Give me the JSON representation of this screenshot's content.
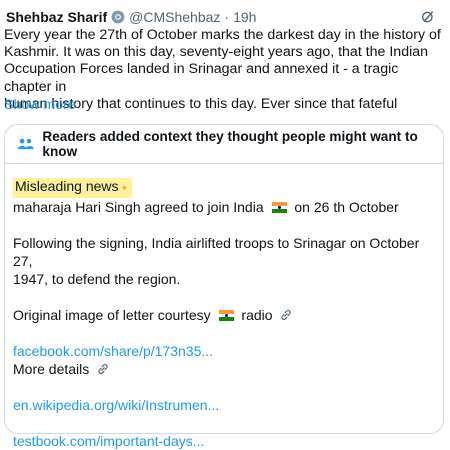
{
  "tweet": {
    "author_name": "Shehbaz Sharif",
    "handle": "@CMShehbaz",
    "separator": "·",
    "time": "19h",
    "text_lines": [
      "Every year the 27th of October marks the darkest day in the history of",
      "Kashmir. It was on this day, seventy-eight years ago, that the Indian",
      "Occupation Forces landed in Srinagar and annexed it - a tragic chapter in",
      "human history that continues to this day. Ever since that fateful"
    ],
    "show_more": "Show more"
  },
  "note": {
    "header": "Readers added context they thought people might want to know",
    "tag": "Misleading news",
    "line1_before": "maharaja Hari Singh agreed to join India",
    "line1_after": "on 26 th October",
    "para2_line1": "Following the signing, India airlifted troops to Srinagar on October 27,",
    "para2_line2": "1947, to defend the region.",
    "para3_before": "Original image of letter courtesy",
    "para3_after": "radio",
    "link1": "facebook.com/share/p/173n35...",
    "more_details": "More details",
    "link2": "en.wikipedia.org/wiki/Instrumen...",
    "link3": "testbook.com/important-days..."
  },
  "icons": {
    "badge": "verified-badge-icon",
    "grok": "grok-icon",
    "people": "people-icon",
    "link": "link-icon",
    "flag": "india-flag-emoji",
    "sparkle": "sparkle-icon"
  },
  "colors": {
    "text": "#0f1419",
    "secondary": "#536471",
    "link": "#1d9bf0",
    "highlight": "#fff09a",
    "people_icon": "#1d9bf0"
  }
}
